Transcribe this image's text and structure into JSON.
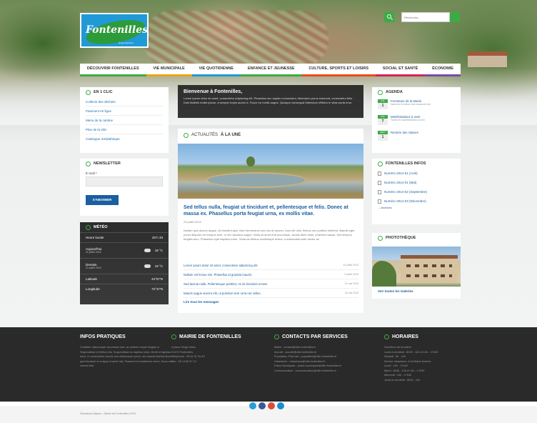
{
  "brand": {
    "name": "Fontenilles",
    "tagline": "Haute-Garonne",
    "logo_color": "#1f9ad6"
  },
  "search": {
    "placeholder": "Recherche..."
  },
  "nav": {
    "items": [
      {
        "label": "DÉCOUVRIR FONTENILLES",
        "color": "#3dab45"
      },
      {
        "label": "VIE MUNICIPALE",
        "color": "#e8a516"
      },
      {
        "label": "VIE QUOTIDIENNE",
        "color": "#1f9ad6"
      },
      {
        "label": "ENFANCE ET JEUNESSE",
        "color": "#3dab45"
      },
      {
        "label": "CULTURE, SPORTS ET LOISIRS",
        "color": "#e84d1c"
      },
      {
        "label": "SOCIAL ET SANTÉ",
        "color": "#d6235a"
      },
      {
        "label": "ÉCONOMIE",
        "color": "#7a4aa8"
      }
    ]
  },
  "quick": {
    "title": "EN 1 CLIC",
    "links": [
      "Collecte des déchets",
      "Paiement en ligne",
      "Menu de la cantine",
      "Plan de la ville",
      "Catalogue médiathèque"
    ]
  },
  "newsletter": {
    "title": "NEWSLETTER",
    "email_label": "E-mail *",
    "button": "S'ABONNER"
  },
  "meteo": {
    "title": "MÉTÉO",
    "rows": [
      {
        "label": "Heure locale",
        "sub": "",
        "value": "20 h 33"
      },
      {
        "label": "Aujourd'hui",
        "sub": "20 juillet 2015",
        "value": "18 °C"
      },
      {
        "label": "Demain",
        "sub": "21 juillet 2015",
        "value": "19 °C"
      },
      {
        "label": "Latitude",
        "sub": "",
        "value": "44°57'N"
      },
      {
        "label": "Longitude",
        "sub": "",
        "value": "72°47'N"
      }
    ]
  },
  "welcome": {
    "title": "Bienvenue à Fontenilles,",
    "text": "Lorem ipsum dolor sit amet, consectetur adipiscing elit. Phasellus nec sapien consectetur, bibendum purus euismod, consectetur felis. Duis facilisis mollis ipsum, a semper turpis auctor a. Fusce eu mollis augue. Quisque consequat bibendum efficitur in vitae porta eros."
  },
  "news": {
    "title_prefix": "ACTUALITÉS ",
    "title_bold": "À LA UNE",
    "headline": "Sed tellus nulla, feugiat ut tincidunt et, pellentesque et felis. Donec at massa ex. Phasellus porta feugiat urna, ex mollis vitae.",
    "date": "20 juillet 2015",
    "body": "Nullam quis dictum augue, sit blandit turpis. Nam fermentum sed orci at laoreet. Duis elit odio, finibus nec porttitor eleifend. Blandit eget purus aliquam vel tempus sem. In nec faucibus augue. Nulla sit amet erat accumsan, iaculis diam vitae, pharetra massa. Sed tempus fringilla arcu. Phasellus eget dapibus tortor. Vivamus finibus scelerisque lectus, a malesuada ante auctor ac.",
    "items": [
      {
        "title": "Lorem ipsum dolor sit amet, consectetur adipiscing elit.",
        "date": "20 juillet 2015"
      },
      {
        "title": "Nullam vel lectus nisi. Phasellus id gravida mauris.",
        "date": "9 juillet 2015"
      },
      {
        "title": "Sed lacinia nulla. Pellentesque porttitor, mi sit tincidunt ornare.",
        "date": "21 mai 2015"
      },
      {
        "title": "Mauris augue viverra elit, ut pulvinar sem urna nec tellus.",
        "date": "16 mai 2015"
      }
    ],
    "all_link": "Lire tous les messages"
  },
  "agenda": {
    "title": "AGENDA",
    "events": [
      {
        "month": "JUIL",
        "day": "1",
        "title": "Fermeture de la Mairie",
        "sub": "Dates de fermeture des vacances mai"
      },
      {
        "month": "JUIL",
        "day": "7",
        "title": "Manifestations à venir",
        "sub": "Toutes les manifestations à venir"
      },
      {
        "month": "SEPT",
        "day": "1",
        "title": "Rentrée des classes",
        "sub": ""
      }
    ]
  },
  "infos": {
    "title": "FONTENILLES INFOS",
    "items": [
      "Numéro 2014-01 (Avril)",
      "Numéro 2014-01 (Mai)",
      "Numéro 2014-02 (Septembre)",
      "Numéro 2014-03 (Décembre)"
    ],
    "archives": "... Archives"
  },
  "photos": {
    "title": "PHOTOTHÈQUE",
    "link": "Voir toutes les Galeries"
  },
  "footer": {
    "pratiques": {
      "title": "INFOS PRATIQUES",
      "text": "Curabitur ullamcorper accumsan erat, ac pretium neque feugiat ut. Suspendisse et finibus nisi. Suspendisse ac dapibus nulla. Morbi et egestas dolor. In consectetur mauris non ullamcorper porta, nec mauris facilisis libero, quis tincidunt ex magna ut amet nisi. Praesent et vestibulum lorem. Nunc non viverra felis."
    },
    "mairie": {
      "title": "MAIRIE DE FONTENILLES",
      "lines": [
        "4 place Serge Dalos",
        "31470 Fontenilles",
        "Téléphone : 05 61 91 93 40",
        "Fax : 05 14 66 57 14"
      ]
    },
    "contacts": {
      "title": "CONTACTS PAR SERVICES",
      "lines": [
        "Mairie : contact@ville-fontenilles.fr",
        "Accueil : accueil@ville-fontenilles.fr",
        "Population, État civil : population@ville-fontenilles.fr",
        "Urbanisme : urbanisme@ville-fontenilles.fr",
        "Police Municipale : police.municipale@ville-fontenilles.fr",
        "Communication : communication@ville-fontenilles.fr"
      ]
    },
    "horaires": {
      "title": "HORAIRES",
      "lines": [
        "Ouverture de la mairie :",
        "Lundi à vendredi : 8h30 - 12h et 14h - 17h30",
        "Samedi : 9h - 12h",
        "Service urbanisme, & la Mairie Annexe :",
        "Lundi : 14h - 17h30",
        "Mardi : 8h30 - 12h et 14h - 17h30",
        "Mercredi : 14h - 17h30",
        "Jeudi et vendredi : 8h30 - 12h"
      ]
    }
  },
  "social": {
    "colors": [
      "#2a9fd6",
      "#3b5998",
      "#dd4b39",
      "#1b8ad3"
    ],
    "icons": [
      "twitter-icon",
      "facebook-icon",
      "googleplus-icon",
      "linkedin-icon"
    ]
  },
  "copyright": "Directeurs Mapeo - Mairie de Fontenilles 2015"
}
